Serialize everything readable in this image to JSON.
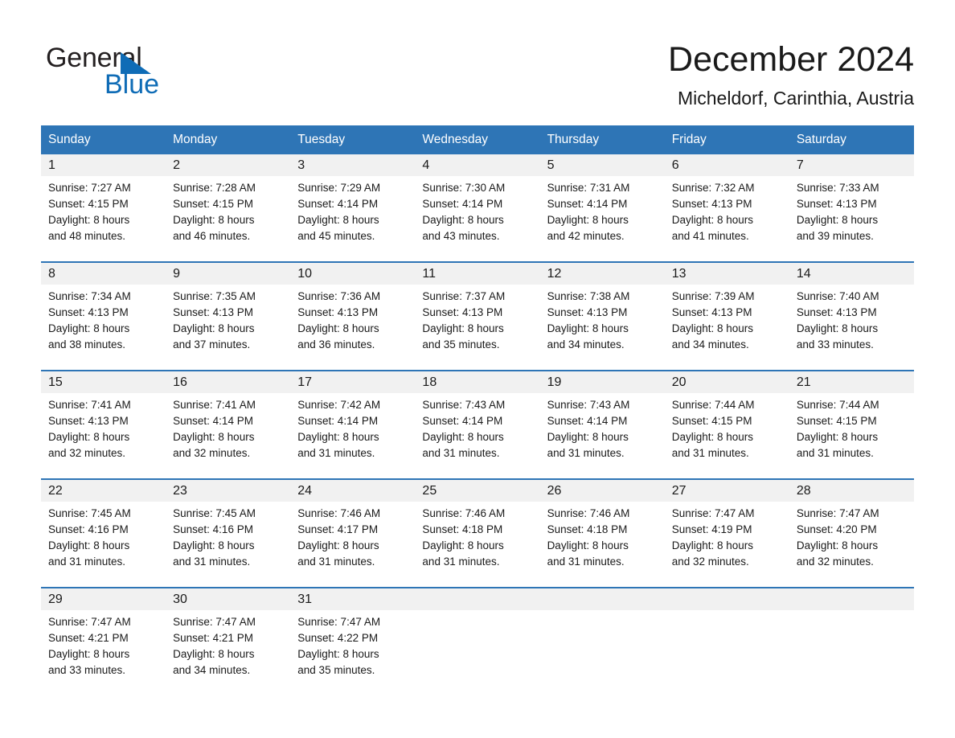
{
  "logo": {
    "word1": "General",
    "word2": "Blue",
    "triangle_color": "#0f6cb6"
  },
  "header": {
    "title": "December 2024",
    "location": "Micheldorf, Carinthia, Austria",
    "accent_color": "#2e75b6"
  },
  "calendar": {
    "weekday_headers": [
      "Sunday",
      "Monday",
      "Tuesday",
      "Wednesday",
      "Thursday",
      "Friday",
      "Saturday"
    ],
    "labels": {
      "sunrise": "Sunrise:",
      "sunset": "Sunset:",
      "daylight": "Daylight:"
    },
    "weeks": [
      [
        {
          "day": "1",
          "sunrise": "Sunrise: 7:27 AM",
          "sunset": "Sunset: 4:15 PM",
          "daylight_l1": "Daylight: 8 hours",
          "daylight_l2": "and 48 minutes."
        },
        {
          "day": "2",
          "sunrise": "Sunrise: 7:28 AM",
          "sunset": "Sunset: 4:15 PM",
          "daylight_l1": "Daylight: 8 hours",
          "daylight_l2": "and 46 minutes."
        },
        {
          "day": "3",
          "sunrise": "Sunrise: 7:29 AM",
          "sunset": "Sunset: 4:14 PM",
          "daylight_l1": "Daylight: 8 hours",
          "daylight_l2": "and 45 minutes."
        },
        {
          "day": "4",
          "sunrise": "Sunrise: 7:30 AM",
          "sunset": "Sunset: 4:14 PM",
          "daylight_l1": "Daylight: 8 hours",
          "daylight_l2": "and 43 minutes."
        },
        {
          "day": "5",
          "sunrise": "Sunrise: 7:31 AM",
          "sunset": "Sunset: 4:14 PM",
          "daylight_l1": "Daylight: 8 hours",
          "daylight_l2": "and 42 minutes."
        },
        {
          "day": "6",
          "sunrise": "Sunrise: 7:32 AM",
          "sunset": "Sunset: 4:13 PM",
          "daylight_l1": "Daylight: 8 hours",
          "daylight_l2": "and 41 minutes."
        },
        {
          "day": "7",
          "sunrise": "Sunrise: 7:33 AM",
          "sunset": "Sunset: 4:13 PM",
          "daylight_l1": "Daylight: 8 hours",
          "daylight_l2": "and 39 minutes."
        }
      ],
      [
        {
          "day": "8",
          "sunrise": "Sunrise: 7:34 AM",
          "sunset": "Sunset: 4:13 PM",
          "daylight_l1": "Daylight: 8 hours",
          "daylight_l2": "and 38 minutes."
        },
        {
          "day": "9",
          "sunrise": "Sunrise: 7:35 AM",
          "sunset": "Sunset: 4:13 PM",
          "daylight_l1": "Daylight: 8 hours",
          "daylight_l2": "and 37 minutes."
        },
        {
          "day": "10",
          "sunrise": "Sunrise: 7:36 AM",
          "sunset": "Sunset: 4:13 PM",
          "daylight_l1": "Daylight: 8 hours",
          "daylight_l2": "and 36 minutes."
        },
        {
          "day": "11",
          "sunrise": "Sunrise: 7:37 AM",
          "sunset": "Sunset: 4:13 PM",
          "daylight_l1": "Daylight: 8 hours",
          "daylight_l2": "and 35 minutes."
        },
        {
          "day": "12",
          "sunrise": "Sunrise: 7:38 AM",
          "sunset": "Sunset: 4:13 PM",
          "daylight_l1": "Daylight: 8 hours",
          "daylight_l2": "and 34 minutes."
        },
        {
          "day": "13",
          "sunrise": "Sunrise: 7:39 AM",
          "sunset": "Sunset: 4:13 PM",
          "daylight_l1": "Daylight: 8 hours",
          "daylight_l2": "and 34 minutes."
        },
        {
          "day": "14",
          "sunrise": "Sunrise: 7:40 AM",
          "sunset": "Sunset: 4:13 PM",
          "daylight_l1": "Daylight: 8 hours",
          "daylight_l2": "and 33 minutes."
        }
      ],
      [
        {
          "day": "15",
          "sunrise": "Sunrise: 7:41 AM",
          "sunset": "Sunset: 4:13 PM",
          "daylight_l1": "Daylight: 8 hours",
          "daylight_l2": "and 32 minutes."
        },
        {
          "day": "16",
          "sunrise": "Sunrise: 7:41 AM",
          "sunset": "Sunset: 4:14 PM",
          "daylight_l1": "Daylight: 8 hours",
          "daylight_l2": "and 32 minutes."
        },
        {
          "day": "17",
          "sunrise": "Sunrise: 7:42 AM",
          "sunset": "Sunset: 4:14 PM",
          "daylight_l1": "Daylight: 8 hours",
          "daylight_l2": "and 31 minutes."
        },
        {
          "day": "18",
          "sunrise": "Sunrise: 7:43 AM",
          "sunset": "Sunset: 4:14 PM",
          "daylight_l1": "Daylight: 8 hours",
          "daylight_l2": "and 31 minutes."
        },
        {
          "day": "19",
          "sunrise": "Sunrise: 7:43 AM",
          "sunset": "Sunset: 4:14 PM",
          "daylight_l1": "Daylight: 8 hours",
          "daylight_l2": "and 31 minutes."
        },
        {
          "day": "20",
          "sunrise": "Sunrise: 7:44 AM",
          "sunset": "Sunset: 4:15 PM",
          "daylight_l1": "Daylight: 8 hours",
          "daylight_l2": "and 31 minutes."
        },
        {
          "day": "21",
          "sunrise": "Sunrise: 7:44 AM",
          "sunset": "Sunset: 4:15 PM",
          "daylight_l1": "Daylight: 8 hours",
          "daylight_l2": "and 31 minutes."
        }
      ],
      [
        {
          "day": "22",
          "sunrise": "Sunrise: 7:45 AM",
          "sunset": "Sunset: 4:16 PM",
          "daylight_l1": "Daylight: 8 hours",
          "daylight_l2": "and 31 minutes."
        },
        {
          "day": "23",
          "sunrise": "Sunrise: 7:45 AM",
          "sunset": "Sunset: 4:16 PM",
          "daylight_l1": "Daylight: 8 hours",
          "daylight_l2": "and 31 minutes."
        },
        {
          "day": "24",
          "sunrise": "Sunrise: 7:46 AM",
          "sunset": "Sunset: 4:17 PM",
          "daylight_l1": "Daylight: 8 hours",
          "daylight_l2": "and 31 minutes."
        },
        {
          "day": "25",
          "sunrise": "Sunrise: 7:46 AM",
          "sunset": "Sunset: 4:18 PM",
          "daylight_l1": "Daylight: 8 hours",
          "daylight_l2": "and 31 minutes."
        },
        {
          "day": "26",
          "sunrise": "Sunrise: 7:46 AM",
          "sunset": "Sunset: 4:18 PM",
          "daylight_l1": "Daylight: 8 hours",
          "daylight_l2": "and 31 minutes."
        },
        {
          "day": "27",
          "sunrise": "Sunrise: 7:47 AM",
          "sunset": "Sunset: 4:19 PM",
          "daylight_l1": "Daylight: 8 hours",
          "daylight_l2": "and 32 minutes."
        },
        {
          "day": "28",
          "sunrise": "Sunrise: 7:47 AM",
          "sunset": "Sunset: 4:20 PM",
          "daylight_l1": "Daylight: 8 hours",
          "daylight_l2": "and 32 minutes."
        }
      ],
      [
        {
          "day": "29",
          "sunrise": "Sunrise: 7:47 AM",
          "sunset": "Sunset: 4:21 PM",
          "daylight_l1": "Daylight: 8 hours",
          "daylight_l2": "and 33 minutes."
        },
        {
          "day": "30",
          "sunrise": "Sunrise: 7:47 AM",
          "sunset": "Sunset: 4:21 PM",
          "daylight_l1": "Daylight: 8 hours",
          "daylight_l2": "and 34 minutes."
        },
        {
          "day": "31",
          "sunrise": "Sunrise: 7:47 AM",
          "sunset": "Sunset: 4:22 PM",
          "daylight_l1": "Daylight: 8 hours",
          "daylight_l2": "and 35 minutes."
        },
        {
          "day": "",
          "sunrise": "",
          "sunset": "",
          "daylight_l1": "",
          "daylight_l2": ""
        },
        {
          "day": "",
          "sunrise": "",
          "sunset": "",
          "daylight_l1": "",
          "daylight_l2": ""
        },
        {
          "day": "",
          "sunrise": "",
          "sunset": "",
          "daylight_l1": "",
          "daylight_l2": ""
        },
        {
          "day": "",
          "sunrise": "",
          "sunset": "",
          "daylight_l1": "",
          "daylight_l2": ""
        }
      ]
    ]
  }
}
